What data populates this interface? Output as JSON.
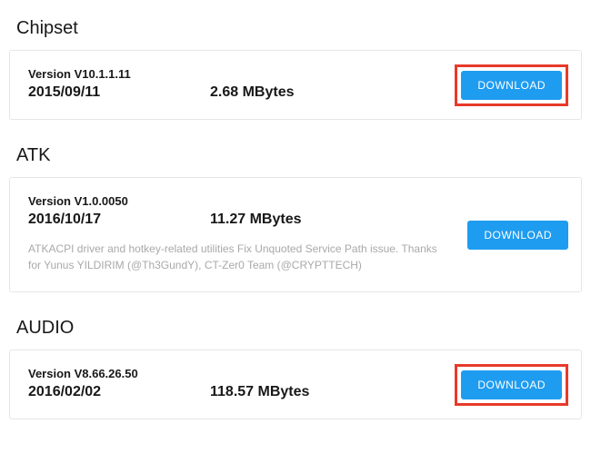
{
  "sections": [
    {
      "title": "Chipset",
      "version": "Version V10.1.1.11",
      "date": "2015/09/11",
      "size": "2.68 MBytes",
      "desc": "",
      "download": "DOWNLOAD",
      "highlighted": true,
      "downloadPos": "low"
    },
    {
      "title": "ATK",
      "version": "Version V1.0.0050",
      "date": "2016/10/17",
      "size": "11.27 MBytes",
      "desc": "ATKACPI driver and hotkey-related utilities Fix Unquoted Service Path issue. Thanks for Yunus YILDIRIM (@Th3GundY), CT-Zer0 Team (@CRYPTTECH)",
      "download": "DOWNLOAD",
      "highlighted": false,
      "downloadPos": "mid"
    },
    {
      "title": "AUDIO",
      "version": "Version V8.66.26.50",
      "date": "2016/02/02",
      "size": "118.57 MBytes",
      "desc": "",
      "download": "DOWNLOAD",
      "highlighted": true,
      "downloadPos": "low"
    }
  ]
}
